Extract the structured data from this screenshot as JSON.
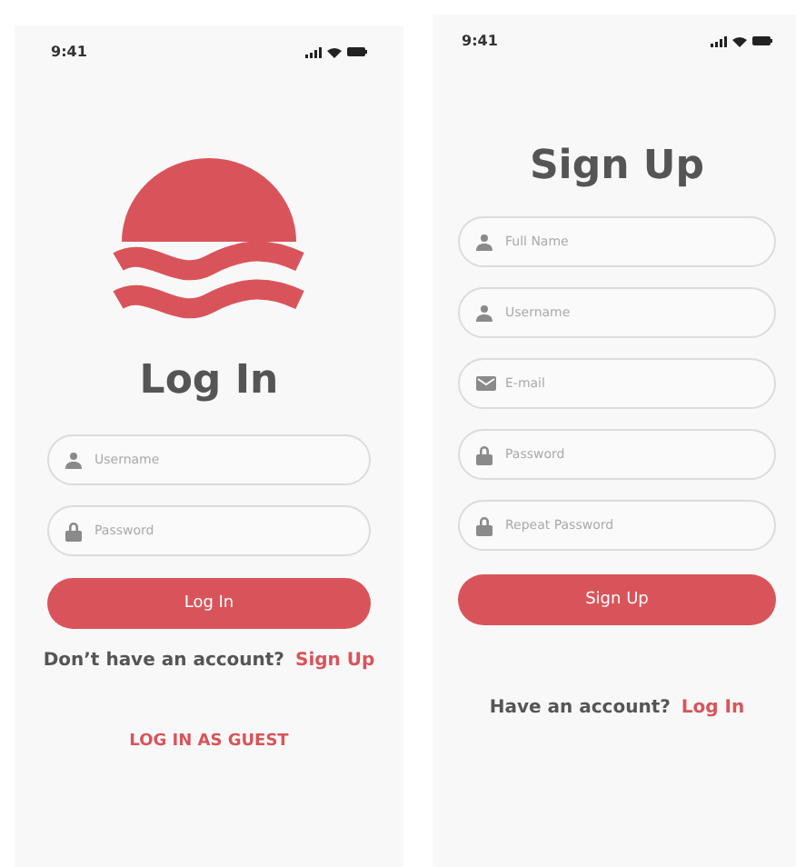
{
  "screens": [
    {
      "kind": "login",
      "status_time": "9:41",
      "title": "Log In",
      "fields": [
        {
          "kind": "user",
          "placeholder": "Username"
        },
        {
          "kind": "lock",
          "placeholder": "Password"
        }
      ],
      "button": "Log In",
      "prompt": "Don’t have an account?",
      "link": "Sign Up",
      "guest": "LOG IN AS GUEST"
    },
    {
      "kind": "signup",
      "status_time": "9:41",
      "title": "Sign Up",
      "fields": [
        {
          "kind": "user",
          "placeholder": "Full Name"
        },
        {
          "kind": "user",
          "placeholder": "Username"
        },
        {
          "kind": "mail",
          "placeholder": "E-mail"
        },
        {
          "kind": "lock",
          "placeholder": "Password"
        },
        {
          "kind": "lock",
          "placeholder": "Repeat Password"
        }
      ],
      "button": "Sign Up",
      "prompt": "Have an account?",
      "link": "Log In"
    }
  ]
}
